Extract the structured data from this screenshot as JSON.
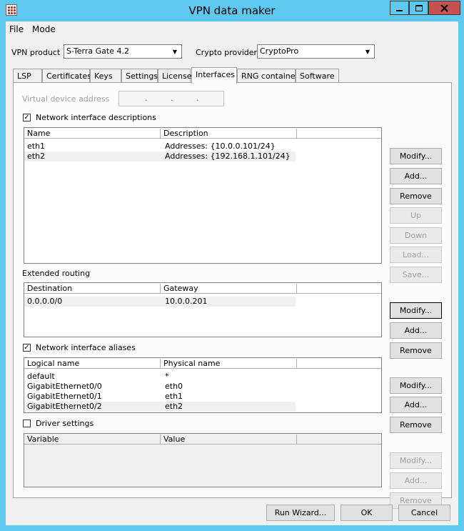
{
  "window": {
    "title": "VPN data maker"
  },
  "menu": [
    "File",
    "Mode"
  ],
  "vpn_product": {
    "label": "VPN product",
    "value": "S-Terra Gate 4.2"
  },
  "crypto_provider": {
    "label": "Crypto provider",
    "value": "CryptoPro"
  },
  "tabs": [
    "LSP",
    "Certificates",
    "Keys",
    "Settings",
    "License",
    "Interfaces",
    "RNG container",
    "Software"
  ],
  "active_tab": "Interfaces",
  "virtual_device": {
    "label": "Virtual device address",
    "dots": ".",
    "enabled": false
  },
  "net_iface_desc": {
    "label": "Network interface descriptions",
    "checked": true,
    "columns": [
      "Name",
      "Description"
    ],
    "rows": [
      [
        "eth1",
        "Addresses: {10.0.0.101/24}"
      ],
      [
        "eth2",
        "Addresses: {192.168.1.101/24}"
      ]
    ],
    "buttons": [
      "Modify...",
      "Add...",
      "Remove",
      "Up",
      "Down",
      "Load...",
      "Save..."
    ]
  },
  "ext_routing": {
    "label": "Extended routing",
    "columns": [
      "Destination",
      "Gateway"
    ],
    "rows": [
      [
        "0.0.0.0/0",
        "10.0.0.201"
      ]
    ],
    "buttons": [
      "Modify...",
      "Add...",
      "Remove"
    ]
  },
  "net_iface_alias": {
    "label": "Network interface aliases",
    "checked": true,
    "columns": [
      "Logical name",
      "Physical name"
    ],
    "rows": [
      [
        "default",
        "*"
      ],
      [
        "GigabitEthernet0/0",
        "eth0"
      ],
      [
        "GigabitEthernet0/1",
        "eth1"
      ],
      [
        "GigabitEthernet0/2",
        "eth2"
      ]
    ],
    "buttons": [
      "Modify...",
      "Add...",
      "Remove"
    ]
  },
  "driver_settings": {
    "label": "Driver settings",
    "checked": false,
    "columns": [
      "Variable",
      "Value"
    ],
    "buttons": [
      "Modify...",
      "Add...",
      "Remove"
    ]
  },
  "footer": {
    "run_wizard": "Run Wizard...",
    "ok": "OK",
    "cancel": "Cancel"
  },
  "colors": {
    "frame": "#5fc8ee",
    "close": "#c75050",
    "panel": "#f0f0f0"
  }
}
